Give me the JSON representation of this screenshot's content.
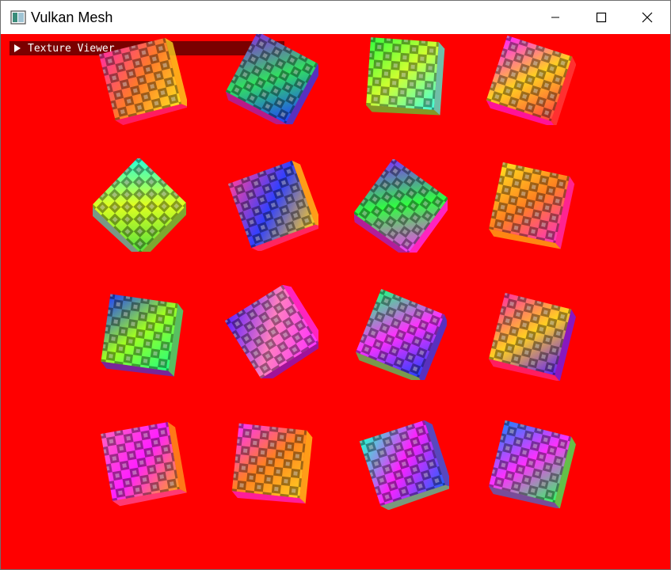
{
  "window": {
    "title": "Vulkan Mesh",
    "icon": "app-window-icon",
    "controls": [
      "minimize-icon",
      "maximize-icon",
      "close-icon"
    ]
  },
  "viewport": {
    "background": "#ff0000"
  },
  "imgui": {
    "header_label": "Texture Viewer",
    "collapsed": true,
    "header_color": "#7a0000"
  },
  "scene": {
    "rows": 4,
    "cols": 4,
    "object": "textured-cube"
  }
}
